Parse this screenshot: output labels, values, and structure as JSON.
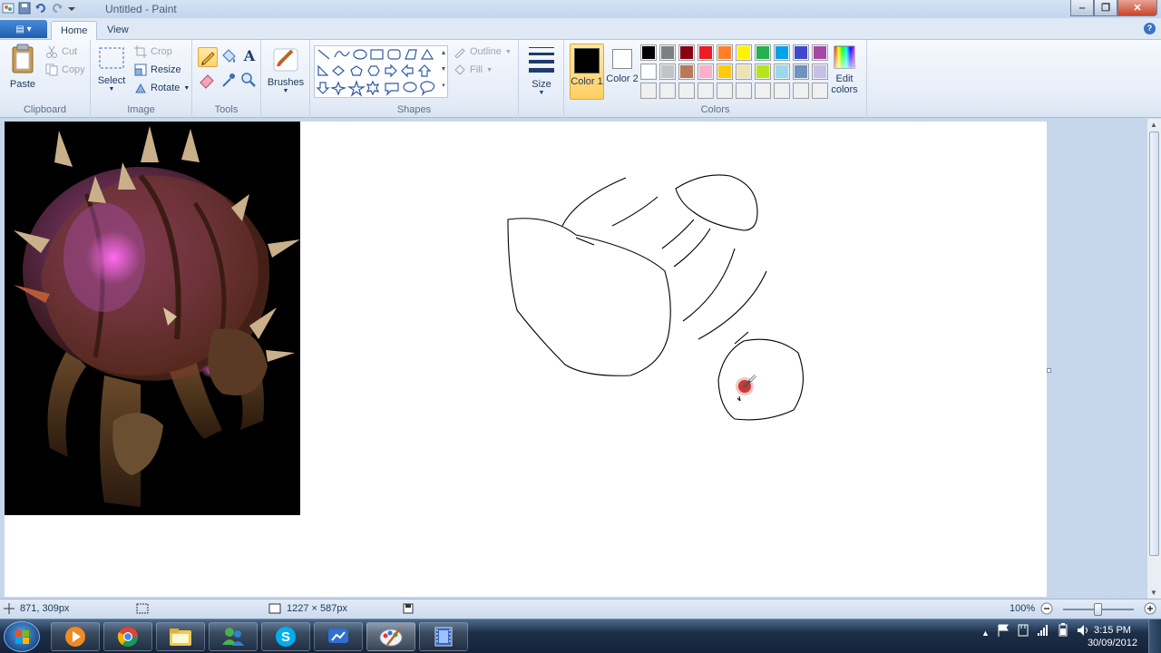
{
  "window": {
    "title": "Untitled - Paint"
  },
  "tabs": {
    "app_menu": "▤ ▾",
    "home": "Home",
    "view": "View",
    "help": "?"
  },
  "clipboard": {
    "paste": "Paste",
    "cut": "Cut",
    "copy": "Copy",
    "label": "Clipboard"
  },
  "image": {
    "select": "Select",
    "crop": "Crop",
    "resize": "Resize",
    "rotate": "Rotate",
    "label": "Image"
  },
  "tools": {
    "label": "Tools",
    "text_tool": "A"
  },
  "brushes": {
    "label": "Brushes"
  },
  "shapes": {
    "outline": "Outline",
    "fill": "Fill",
    "label": "Shapes"
  },
  "size": {
    "label": "Size"
  },
  "colors": {
    "color1_label": "Color 1",
    "color2_label": "Color 2",
    "color1": "#000000",
    "color2": "#ffffff",
    "edit_label": "Edit colors",
    "label": "Colors",
    "palette_row1": [
      "#000000",
      "#7f7f7f",
      "#880015",
      "#ed1c24",
      "#ff7f27",
      "#fff200",
      "#22b14c",
      "#00a2e8",
      "#3f48cc",
      "#a349a4"
    ],
    "palette_row2": [
      "#ffffff",
      "#c3c3c3",
      "#b97a57",
      "#ffaec9",
      "#ffc90e",
      "#efe4b0",
      "#b5e61d",
      "#99d9ea",
      "#7092be",
      "#c8bfe7"
    ],
    "palette_row3": [
      "#f0f0f0",
      "#f0f0f0",
      "#f0f0f0",
      "#f0f0f0",
      "#f0f0f0",
      "#f0f0f0",
      "#f0f0f0",
      "#f0f0f0",
      "#f0f0f0",
      "#f0f0f0"
    ]
  },
  "status": {
    "cursor_pos": "871, 309px",
    "canvas_size": "1227 × 587px",
    "zoom": "100%"
  },
  "taskbar": {
    "time": "3:15 PM",
    "date": "30/09/2012",
    "apps": [
      "windows-media-player-icon",
      "chrome-icon",
      "file-explorer-icon",
      "live-messenger-icon",
      "skype-icon",
      "messenger-icon",
      "paint-icon",
      "film-icon"
    ]
  }
}
